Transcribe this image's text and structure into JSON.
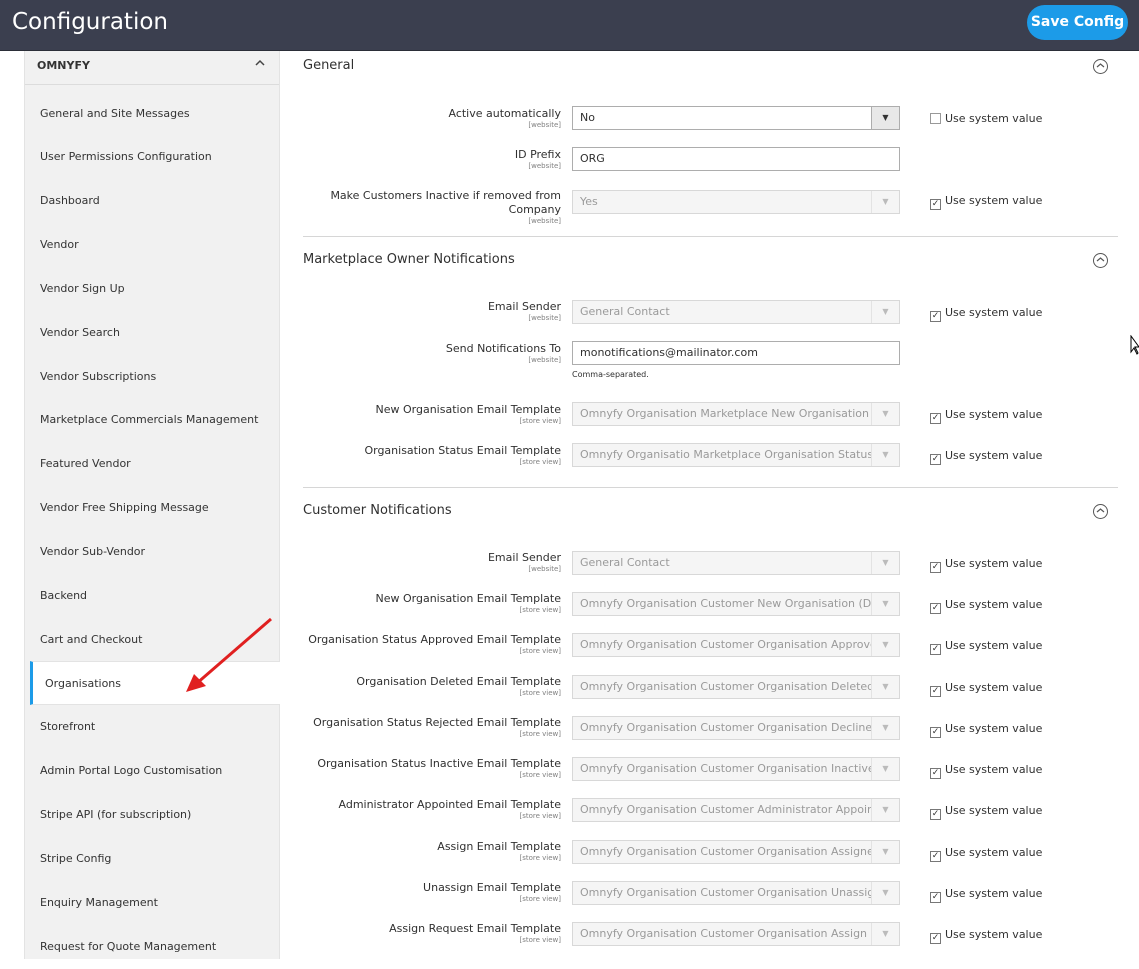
{
  "header": {
    "title": "Configuration",
    "save_label": "Save Config"
  },
  "sidebar": {
    "group": "OMNYFY",
    "items": [
      "General and Site Messages",
      "User Permissions Configuration",
      "Dashboard",
      "Vendor",
      "Vendor Sign Up",
      "Vendor Search",
      "Vendor Subscriptions",
      "Marketplace Commercials Management",
      "Featured Vendor",
      "Vendor Free Shipping Message",
      "Vendor Sub-Vendor",
      "Backend",
      "Cart and Checkout",
      "Organisations",
      "Storefront",
      "Admin Portal Logo Customisation",
      "Stripe API (for subscription)",
      "Stripe Config",
      "Enquiry Management",
      "Request for Quote Management"
    ],
    "active": "Organisations"
  },
  "use_system_value": "Use system value",
  "sections": {
    "general": {
      "title": "General",
      "active_label": "Active automatically",
      "active_scope": "[website]",
      "active_value": "No",
      "prefix_label": "ID Prefix",
      "prefix_scope": "[website]",
      "prefix_value": "ORG",
      "inactive_label_1": "Make Customers Inactive if removed from",
      "inactive_label_2": "Company",
      "inactive_scope": "[website]",
      "inactive_value": "Yes"
    },
    "owner": {
      "title": "Marketplace Owner Notifications",
      "sender_label": "Email Sender",
      "sender_scope": "[website]",
      "sender_value": "General Contact",
      "sendto_label": "Send Notifications To",
      "sendto_scope": "[website]",
      "sendto_value": "monotifications@mailinator.com",
      "sendto_note": "Comma-separated.",
      "neworg_label": "New Organisation Email Template",
      "neworg_scope": "[store view]",
      "neworg_value": "Omnyfy Organisation Marketplace New Organisation (Defa",
      "status_label": "Organisation Status Email Template",
      "status_scope": "[store view]",
      "status_value": "Omnyfy Organisatio Marketplace Organisation Status (Defa"
    },
    "customer": {
      "title": "Customer Notifications",
      "rows": [
        {
          "label": "Email Sender",
          "scope": "[website]",
          "value": "General Contact"
        },
        {
          "label": "New Organisation Email Template",
          "scope": "[store view]",
          "value": "Omnyfy Organisation Customer New Organisation (Default"
        },
        {
          "label": "Organisation Status Approved Email Template",
          "scope": "[store view]",
          "value": "Omnyfy Organisation Customer Organisation Approved (De"
        },
        {
          "label": "Organisation Deleted Email Template",
          "scope": "[store view]",
          "value": "Omnyfy Organisation Customer Organisation Deleted (Defa"
        },
        {
          "label": "Organisation Status Rejected Email Template",
          "scope": "[store view]",
          "value": "Omnyfy Organisation Customer Organisation Declined (De"
        },
        {
          "label": "Organisation Status Inactive Email Template",
          "scope": "[store view]",
          "value": "Omnyfy Organisation Customer Organisation Inactive (Defa"
        },
        {
          "label": "Administrator Appointed Email Template",
          "scope": "[store view]",
          "value": "Omnyfy Organisation Customer Administrator Appointed ("
        },
        {
          "label": "Assign Email Template",
          "scope": "[store view]",
          "value": "Omnyfy Organisation Customer Organisation Assigned (De"
        },
        {
          "label": "Unassign Email Template",
          "scope": "[store view]",
          "value": "Omnyfy Organisation Customer Organisation Unassigned ("
        },
        {
          "label": "Assign Request Email Template",
          "scope": "[store view]",
          "value": "Omnyfy Organisation Customer Organisation Assign Reque"
        }
      ]
    }
  },
  "colors": {
    "header_bg": "#3b3f4f",
    "accent": "#1c9be8",
    "annotation_arrow": "#e02020"
  }
}
